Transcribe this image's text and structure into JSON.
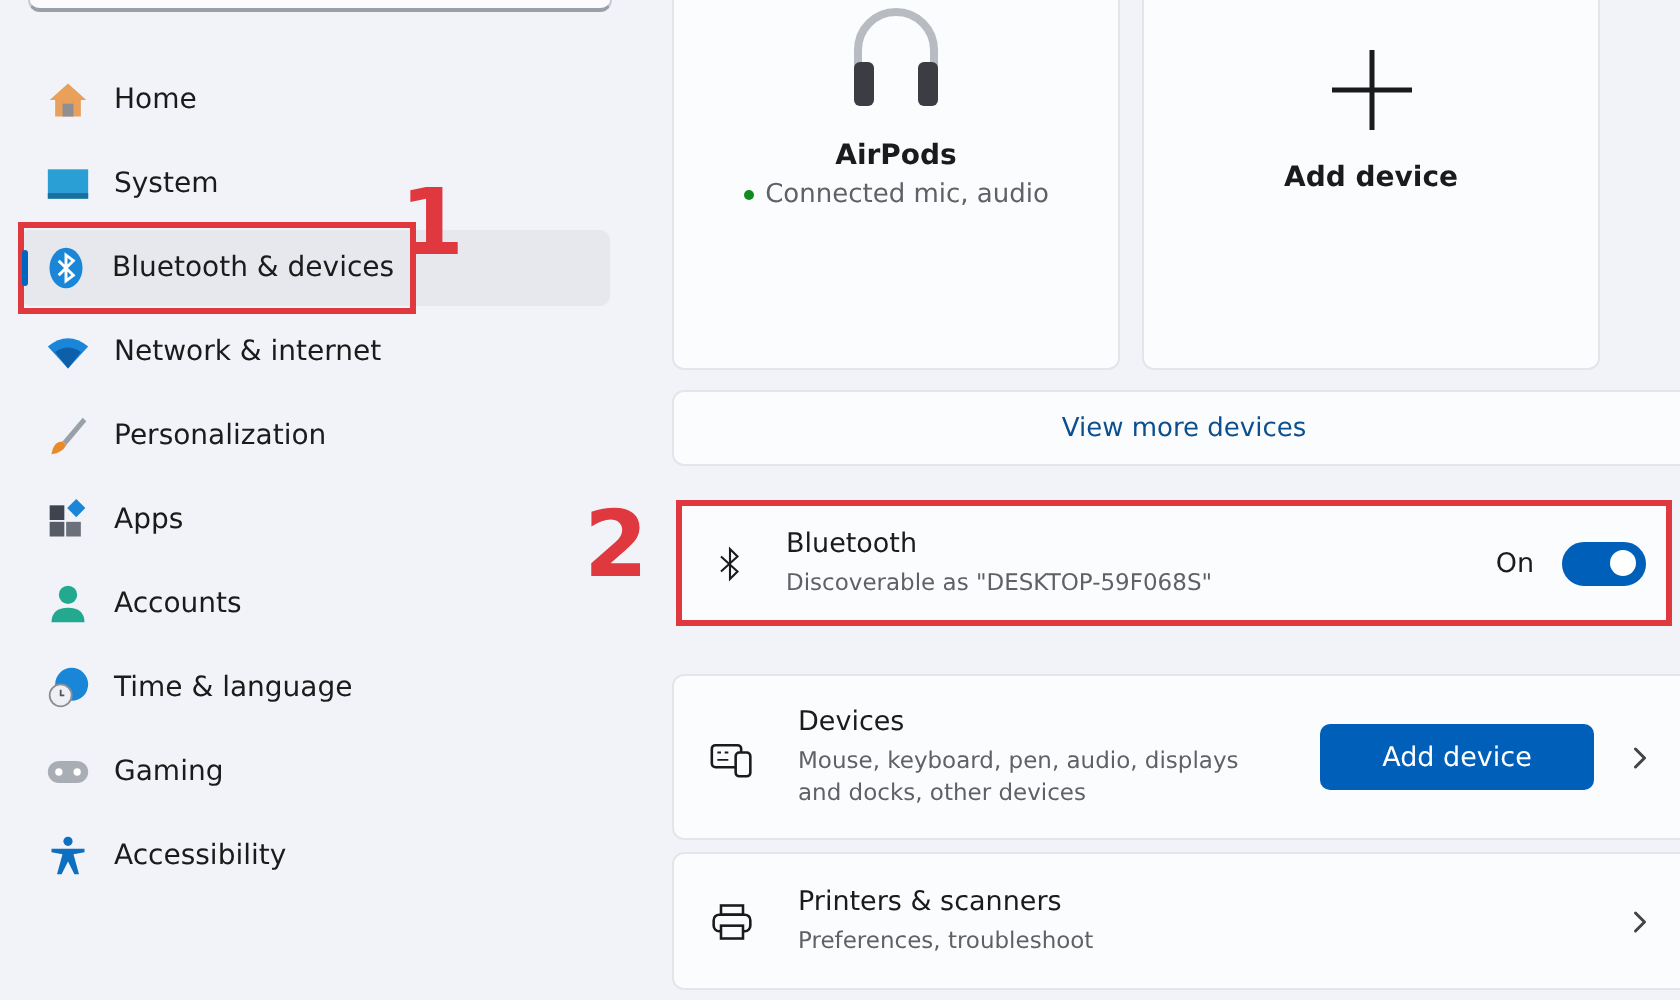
{
  "sidebar": {
    "items": [
      {
        "label": "Home",
        "selected": false
      },
      {
        "label": "System",
        "selected": false
      },
      {
        "label": "Bluetooth & devices",
        "selected": true,
        "annotation": "1"
      },
      {
        "label": "Network & internet",
        "selected": false
      },
      {
        "label": "Personalization",
        "selected": false
      },
      {
        "label": "Apps",
        "selected": false
      },
      {
        "label": "Accounts",
        "selected": false
      },
      {
        "label": "Time & language",
        "selected": false
      },
      {
        "label": "Gaming",
        "selected": false
      },
      {
        "label": "Accessibility",
        "selected": false
      }
    ]
  },
  "device_tiles": [
    {
      "kind": "device",
      "name": "AirPods",
      "status": "Connected mic, audio"
    },
    {
      "kind": "add",
      "name": "Add device"
    }
  ],
  "view_more": "View more devices",
  "bluetooth": {
    "title": "Bluetooth",
    "subtitle": "Discoverable as \"DESKTOP-59F068S\"",
    "state_label": "On",
    "on": true,
    "annotation": "2"
  },
  "settings_rows": [
    {
      "kind": "devices",
      "title": "Devices",
      "subtitle": "Mouse, keyboard, pen, audio, displays and docks, other devices",
      "button": "Add device"
    },
    {
      "kind": "printers",
      "title": "Printers & scanners",
      "subtitle": "Preferences, troubleshoot"
    }
  ]
}
